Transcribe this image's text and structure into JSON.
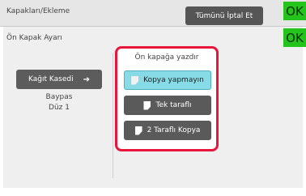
{
  "header": {
    "title": "Kapakları/Ekleme",
    "cancel_all_label": "Tümünü İptal Et",
    "ok_label": "OK"
  },
  "panel": {
    "subtitle": "Ön Kapak Ayarı",
    "ok_label": "OK",
    "paper_tray_button": "Kağıt Kasedi",
    "paper_source": "Baypas",
    "paper_type": "Düz 1"
  },
  "print_on_cover": {
    "heading": "Ön kapağa yazdır",
    "selected": "Kopya yapmayın",
    "options": [
      {
        "label": "Kopya yapmayın"
      },
      {
        "label": "Tek taraflı"
      },
      {
        "label": "2 Taraflı Kopya"
      }
    ],
    "highlight_color": "#e8163b"
  },
  "colors": {
    "ok_green": "#25c41d",
    "selected_cyan": "#86dbe6"
  }
}
